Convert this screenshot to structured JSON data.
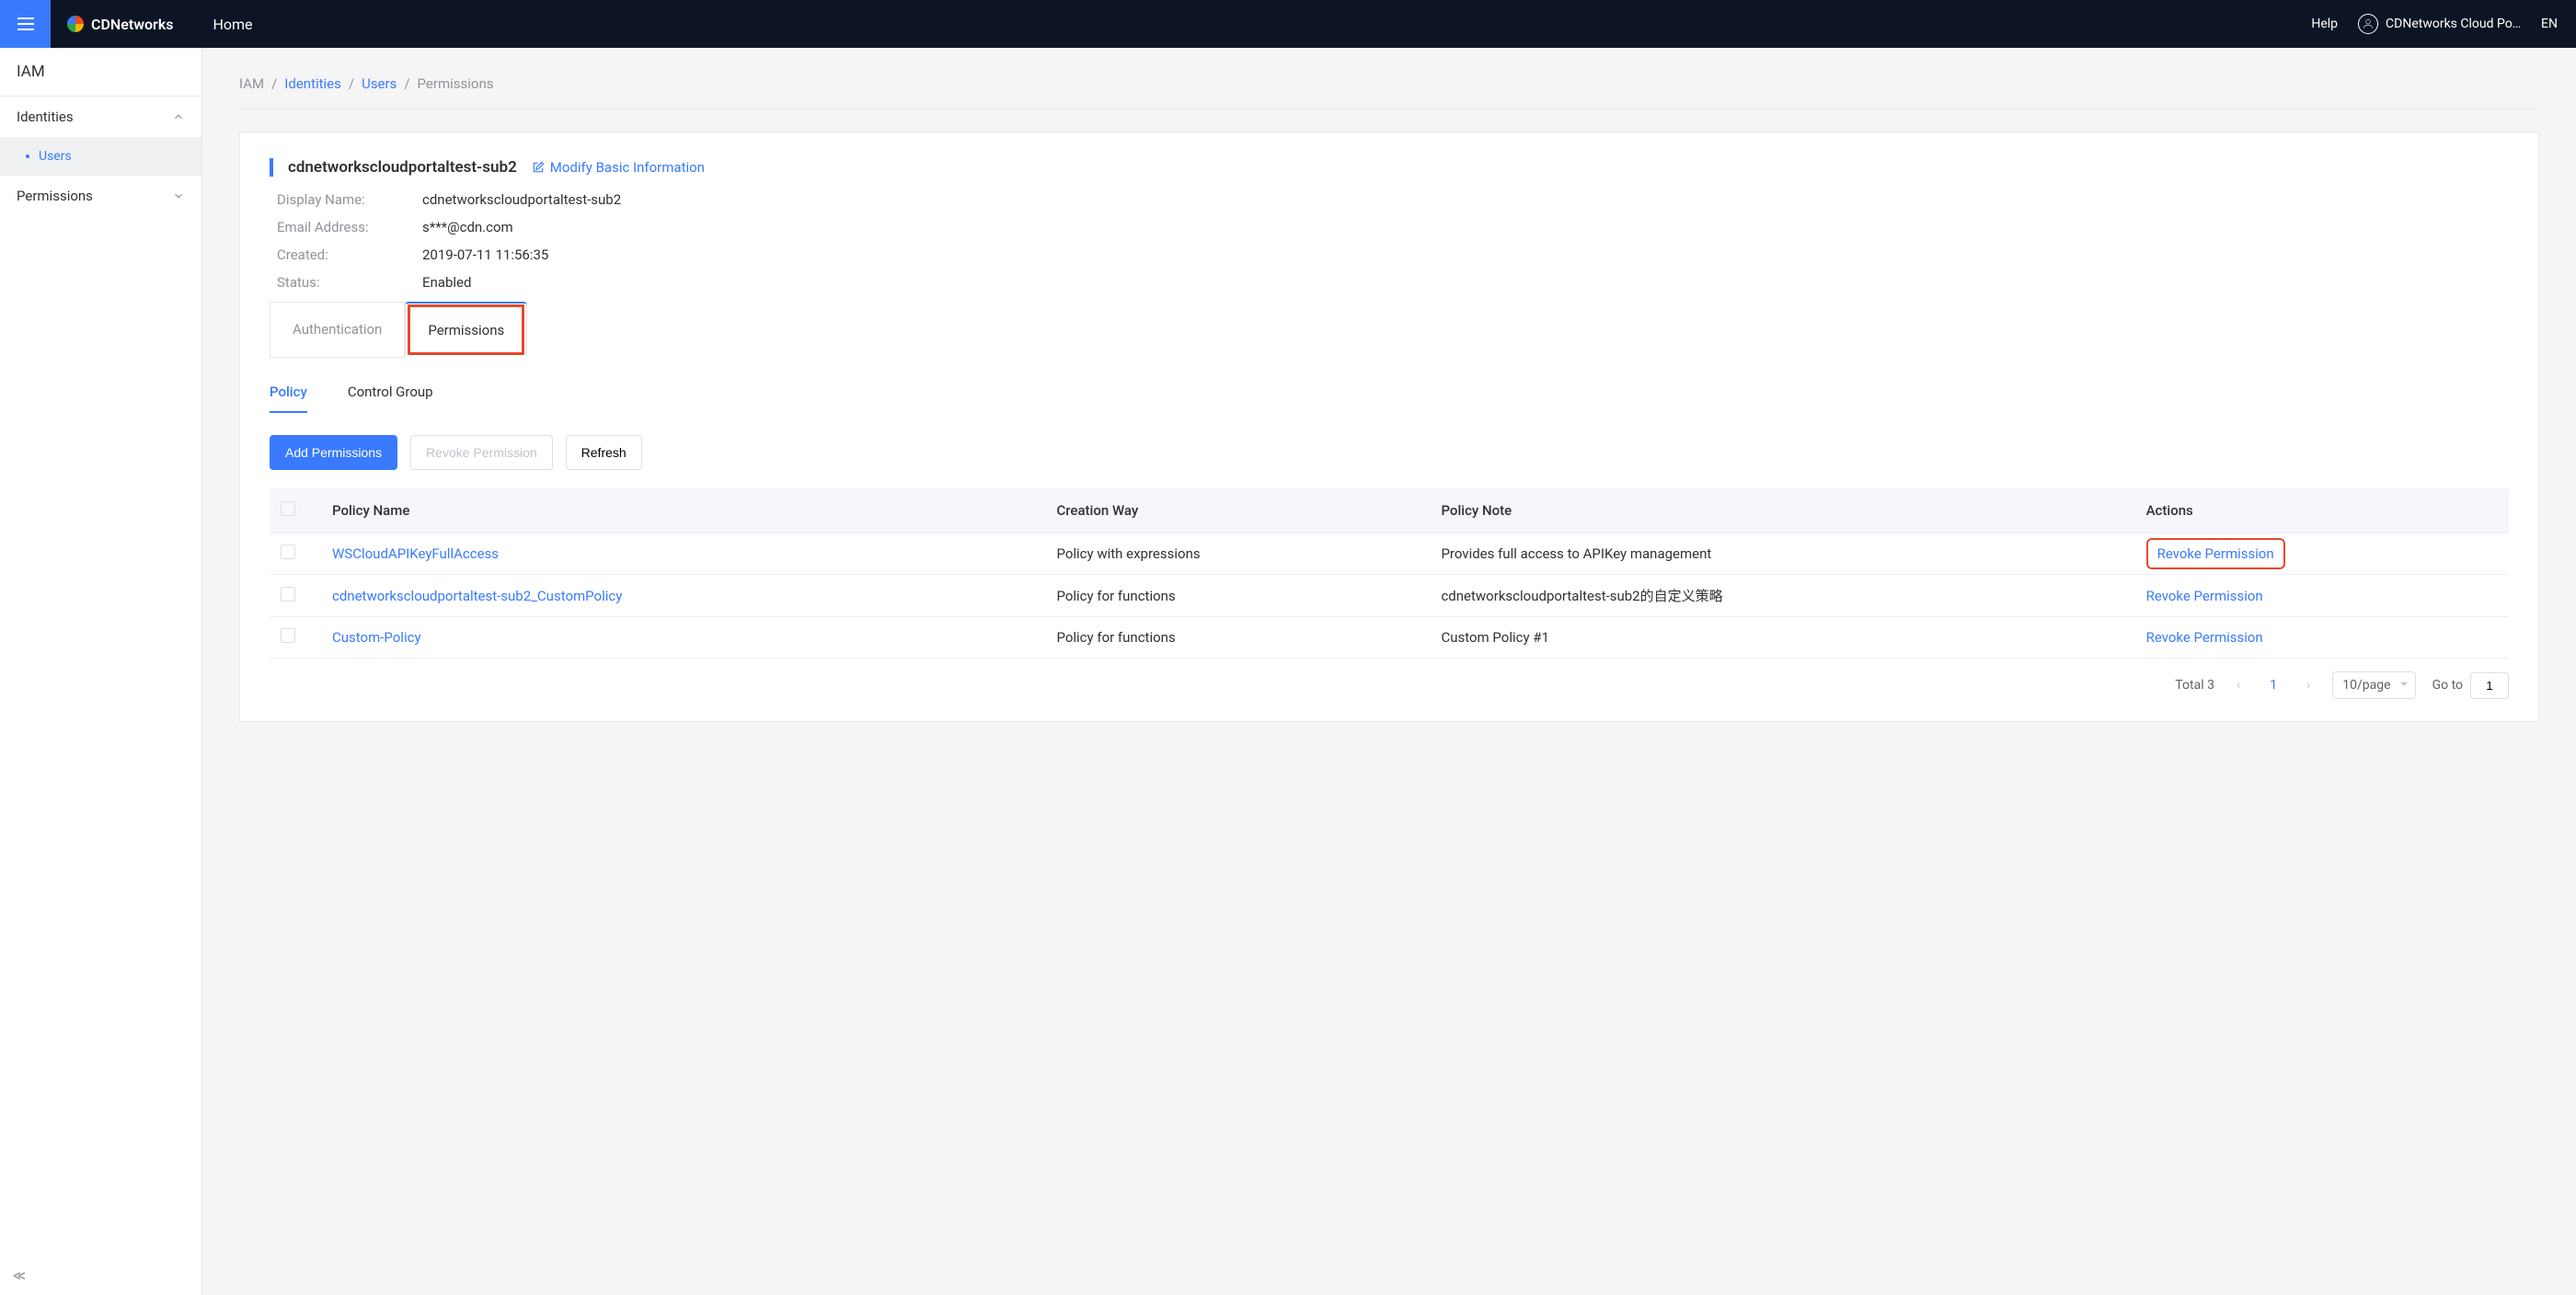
{
  "topbar": {
    "brand": "CDNetworks",
    "home": "Home",
    "help": "Help",
    "user": "CDNetworks Cloud Po…",
    "lang": "EN"
  },
  "sidebar": {
    "title": "IAM",
    "group_identities": "Identities",
    "item_users": "Users",
    "group_permissions": "Permissions"
  },
  "breadcrumb": {
    "iam": "IAM",
    "identities": "Identities",
    "users": "Users",
    "permissions": "Permissions"
  },
  "detail": {
    "name": "cdnetworkscloudportaltest-sub2",
    "modify": "Modify Basic Information",
    "display_name_k": "Display Name:",
    "display_name_v": "cdnetworkscloudportaltest-sub2",
    "email_k": "Email Address:",
    "email_v": "s***@cdn.com",
    "created_k": "Created:",
    "created_v": "2019-07-11 11:56:35",
    "status_k": "Status:",
    "status_v": "Enabled"
  },
  "tabs1": {
    "auth": "Authentication",
    "perm": "Permissions"
  },
  "tabs2": {
    "policy": "Policy",
    "cg": "Control Group"
  },
  "buttons": {
    "add": "Add Permissions",
    "revoke": "Revoke Permission",
    "refresh": "Refresh"
  },
  "table": {
    "headers": {
      "name": "Policy Name",
      "way": "Creation Way",
      "note": "Policy Note",
      "actions": "Actions"
    },
    "rows": [
      {
        "name": "WSCloudAPIKeyFullAccess",
        "way": "Policy with expressions",
        "note": "Provides full access to APIKey management",
        "action": "Revoke Permission",
        "hl": true
      },
      {
        "name": "cdnetworkscloudportaltest-sub2_CustomPolicy",
        "way": "Policy for functions",
        "note": "cdnetworkscloudportaltest-sub2的自定义策略",
        "action": "Revoke Permission",
        "hl": false
      },
      {
        "name": "Custom-Policy",
        "way": "Policy for functions",
        "note": "Custom Policy #1",
        "action": "Revoke Permission",
        "hl": false
      }
    ]
  },
  "pager": {
    "total": "Total 3",
    "current": "1",
    "per": "10/page",
    "goto": "Go to",
    "goto_val": "1"
  }
}
